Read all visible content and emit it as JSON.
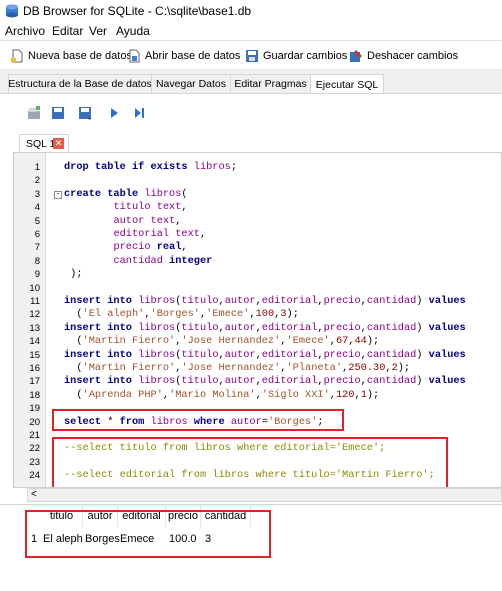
{
  "window": {
    "title": "DB Browser for SQLite - C:\\sqlite\\base1.db"
  },
  "menu": [
    "Archivo",
    "Editar",
    "Ver",
    "Ayuda"
  ],
  "toolbar": {
    "new_db": "Nueva base de datos",
    "open_db": "Abrir base de datos",
    "save": "Guardar cambios",
    "undo": "Deshacer cambios"
  },
  "tabs": [
    "Estructura de la Base de datos",
    "Navegar Datos",
    "Editar Pragmas",
    "Ejecutar SQL"
  ],
  "active_tab": "Ejecutar SQL",
  "sql_tab": {
    "label": "SQL 1"
  },
  "editor": {
    "line_numbers": [
      "1",
      "2",
      "3",
      "4",
      "5",
      "6",
      "7",
      "8",
      "9",
      "10",
      "11",
      "12",
      "13",
      "14",
      "15",
      "16",
      "17",
      "18",
      "19",
      "20",
      "21",
      "22",
      "23",
      "24"
    ]
  },
  "results": {
    "columns": [
      "titulo",
      "autor",
      "editorial",
      "precio",
      "cantidad"
    ],
    "rows": [
      {
        "n": "1",
        "cells": [
          "El aleph",
          "Borges",
          "Emece",
          "100.0",
          "3"
        ]
      }
    ]
  },
  "colors": {
    "highlight_box": "#e0242a",
    "keyword": "#00008b",
    "identifier": "#8b008b",
    "string": "#a0522d",
    "comment": "#8b8b00"
  }
}
